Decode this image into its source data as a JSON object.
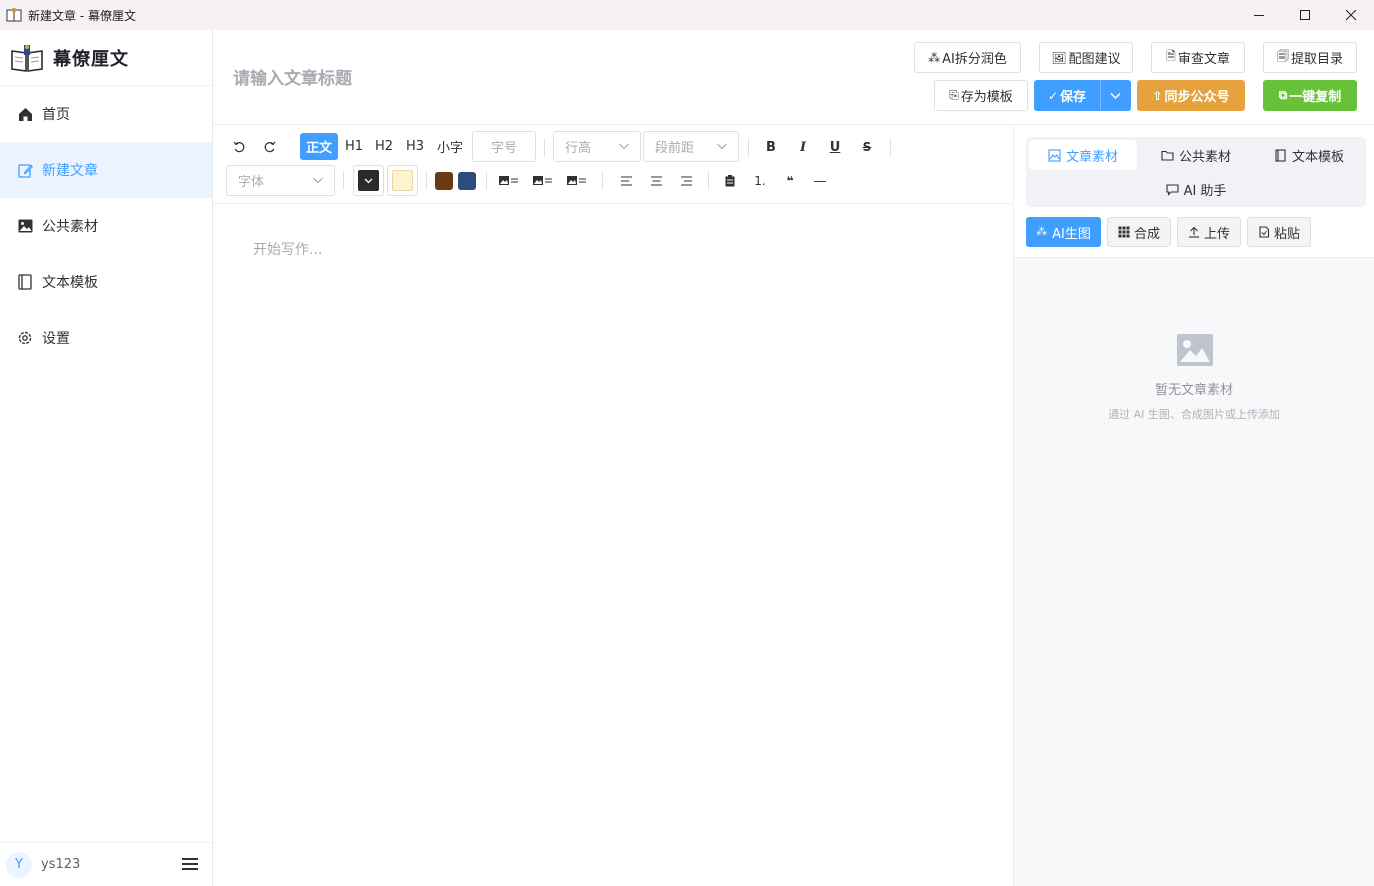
{
  "window": {
    "title": "新建文章 - 幕僚厘文"
  },
  "sidebar": {
    "brand": "幕僚厘文",
    "items": [
      {
        "label": "首页",
        "icon": "home-icon"
      },
      {
        "label": "新建文章",
        "icon": "edit-icon",
        "active": true
      },
      {
        "label": "公共素材",
        "icon": "image-icon"
      },
      {
        "label": "文本模板",
        "icon": "notebook-icon"
      },
      {
        "label": "设置",
        "icon": "gear-icon"
      }
    ],
    "user": {
      "avatar": "Y",
      "name": "ys123"
    }
  },
  "header": {
    "title_placeholder": "请输入文章标题",
    "buttons": {
      "ai_polish": "AI拆分润色",
      "image_suggest": "配图建议",
      "review": "审查文章",
      "extract_toc": "提取目录",
      "save_template": "存为模板",
      "save": "保存",
      "sync_wechat": "同步公众号",
      "copy_all": "一键复制"
    }
  },
  "toolbar": {
    "styles": {
      "body": "正文",
      "h1": "H1",
      "h2": "H2",
      "h3": "H3",
      "small": "小字"
    },
    "font_size_placeholder": "字号",
    "line_height_placeholder": "行高",
    "para_spacing_placeholder": "段前距",
    "font_family_placeholder": "字体",
    "bold": "B",
    "italic": "I",
    "underline": "U",
    "strike": "S",
    "ordered_list": "1.",
    "quote": "❝",
    "hr": "—",
    "colors": {
      "text": "#2b2b2b",
      "highlight": "#fdf3cf",
      "brown": "#6b3a17",
      "navy": "#2f4a7c"
    }
  },
  "editor": {
    "placeholder": "开始写作..."
  },
  "panel": {
    "tabs": [
      "文章素材",
      "公共素材",
      "文本模板",
      "AI 助手"
    ],
    "actions": [
      "AI生图",
      "合成",
      "上传",
      "粘贴"
    ],
    "empty_title": "暂无文章素材",
    "empty_sub": "通过 AI 生图、合成图片或上传添加"
  },
  "theme": {
    "primary": "#409eff",
    "warning": "#e6a23c",
    "success": "#67c23a"
  }
}
